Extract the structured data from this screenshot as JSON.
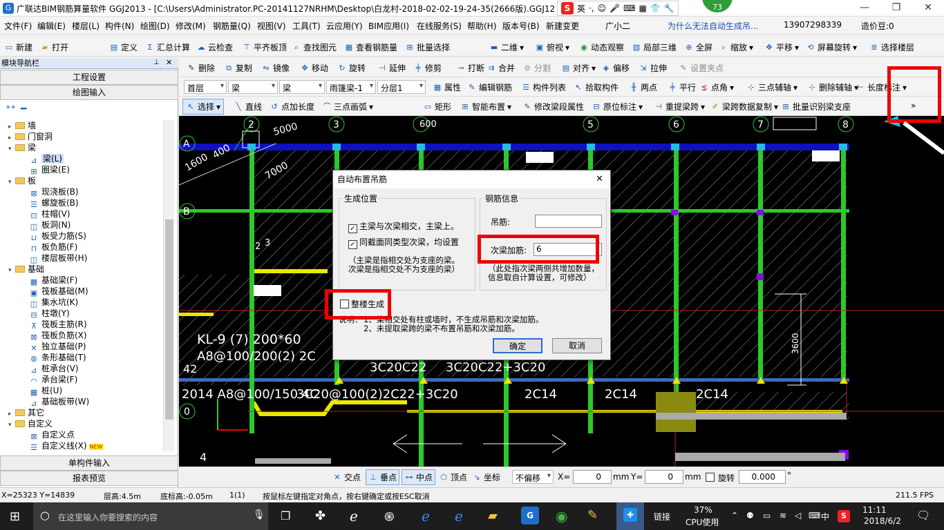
{
  "window": {
    "title": "广联达BIM钢筋算量软件 GGJ2013 - [C:\\Users\\Administrator.PC-20141127NRHM\\Desktop\\白龙村-2018-02-02-19-24-35(2666版).GGJ12]",
    "badge": "73",
    "ime_lang": "英",
    "min": "—",
    "restore": "❐",
    "close": "✕"
  },
  "menu": [
    "文件(F)",
    "编辑(E)",
    "楼层(L)",
    "构件(N)",
    "绘图(D)",
    "修改(M)",
    "钢筋量(Q)",
    "视图(V)",
    "工具(T)",
    "云应用(Y)",
    "BIM应用(I)",
    "在线服务(S)",
    "帮助(H)",
    "版本号(B)",
    "新建变更",
    "广小二",
    "为什么无法自动生成吊...",
    "13907298339",
    "造价豆:0"
  ],
  "toolbar1": [
    "新建",
    "打开",
    "定义",
    "汇总计算",
    "云检查",
    "平齐板顶",
    "查找图元",
    "查看钢筋量",
    "批量选择",
    "二维",
    "俯视",
    "动态观察",
    "局部三维",
    "全屏",
    "缩放",
    "平移",
    "屏幕旋转",
    "选择楼层"
  ],
  "toolbar2": [
    "删除",
    "复制",
    "镜像",
    "移动",
    "旋转",
    "延伸",
    "修剪",
    "打断",
    "合并",
    "分割",
    "对齐",
    "偏移",
    "拉伸",
    "设置夹点"
  ],
  "toolbar3": {
    "floor": "首层",
    "cat": "梁",
    "type": "梁",
    "member": "雨篷梁-1",
    "layer": "分层1",
    "items": [
      "属性",
      "编辑钢筋",
      "构件列表",
      "拾取构件",
      "两点",
      "平行",
      "点角",
      "三点辅轴",
      "删除辅轴",
      "长度标注"
    ]
  },
  "toolbar4": [
    "选择",
    "直线",
    "点加长度",
    "三点画弧",
    "矩形",
    "智能布置",
    "修改梁段属性",
    "原位标注",
    "重提梁跨",
    "梁跨数据复制",
    "批量识别梁支座"
  ],
  "nav": {
    "header": "模块导航栏",
    "btn_project": "工程设置",
    "btn_draw": "绘图输入",
    "btn_single": "单构件输入",
    "btn_report": "报表预览",
    "tree": [
      {
        "label": "墙",
        "lvl": 0,
        "exp": "▸"
      },
      {
        "label": "门窗洞",
        "lvl": 0,
        "exp": "▸"
      },
      {
        "label": "梁",
        "lvl": 0,
        "exp": "▾"
      },
      {
        "label": "梁(L)",
        "lvl": 1,
        "sel": true
      },
      {
        "label": "圈梁(E)",
        "lvl": 1
      },
      {
        "label": "板",
        "lvl": 0,
        "exp": "▾"
      },
      {
        "label": "现浇板(B)",
        "lvl": 1
      },
      {
        "label": "螺旋板(B)",
        "lvl": 1
      },
      {
        "label": "柱帽(V)",
        "lvl": 1
      },
      {
        "label": "板洞(N)",
        "lvl": 1
      },
      {
        "label": "板受力筋(S)",
        "lvl": 1
      },
      {
        "label": "板负筋(F)",
        "lvl": 1
      },
      {
        "label": "楼层板带(H)",
        "lvl": 1
      },
      {
        "label": "基础",
        "lvl": 0,
        "exp": "▾"
      },
      {
        "label": "基础梁(F)",
        "lvl": 1
      },
      {
        "label": "筏板基础(M)",
        "lvl": 1
      },
      {
        "label": "集水坑(K)",
        "lvl": 1
      },
      {
        "label": "柱墩(Y)",
        "lvl": 1
      },
      {
        "label": "筏板主筋(R)",
        "lvl": 1
      },
      {
        "label": "筏板负筋(X)",
        "lvl": 1
      },
      {
        "label": "独立基础(P)",
        "lvl": 1
      },
      {
        "label": "条形基础(T)",
        "lvl": 1
      },
      {
        "label": "桩承台(V)",
        "lvl": 1
      },
      {
        "label": "承台梁(F)",
        "lvl": 1
      },
      {
        "label": "桩(U)",
        "lvl": 1
      },
      {
        "label": "基础板带(W)",
        "lvl": 1
      },
      {
        "label": "其它",
        "lvl": 0,
        "exp": "▸"
      },
      {
        "label": "自定义",
        "lvl": 0,
        "exp": "▾"
      },
      {
        "label": "自定义点",
        "lvl": 1
      },
      {
        "label": "自定义线(X)",
        "lvl": 1,
        "tag": "NEW"
      }
    ]
  },
  "drawing": {
    "axes": [
      "2",
      "3",
      "5",
      "6",
      "7",
      "8"
    ],
    "axis_a": "A",
    "axis_b": "B",
    "axis_0": "0",
    "dims": [
      "5000",
      "600",
      "1600",
      "400",
      "7000",
      "3600"
    ],
    "labels": [
      "KL-9 (7)  200*60",
      "A8@100/200(2)  2C",
      "3C20C22",
      "3C20C22+3C20",
      "2C14",
      "2C14",
      "2C14",
      "2014 A8@100/150 4C",
      "3C20@100(2)2C22+3C20",
      "42",
      "4",
      "0",
      "2",
      "3",
      "C"
    ]
  },
  "dialog": {
    "title": "自动布置吊筋",
    "close": "✕",
    "grp_pos": "生成位置",
    "cb1": "主梁与次梁相交，主梁上。",
    "cb2": "同截面同类型次梁，均设置",
    "note1": "（主梁是指相交处为支座的梁。",
    "note2": "次梁是指相交处不为支座的梁）",
    "grp_rebar": "钢筋信息",
    "lbl_hanger": "吊筋:",
    "val_hanger": "",
    "lbl_sec": "次梁加筋:",
    "val_sec": "6",
    "note3": "（此处指次梁两侧共增加数量，",
    "note4": "信息取自计算设置，可修改）",
    "cb3": "整楼生成",
    "remark_head": "说明：",
    "remark1": "1、梁相交处有柱或墙时，不生成吊筋和次梁加筋。",
    "remark2": "2、未提取梁跨的梁不布置吊筋和次梁加筋。",
    "ok": "确定",
    "cancel": "取消",
    "cb1_checked": "✓",
    "cb2_checked": "✓",
    "cb3_checked": ""
  },
  "snap": {
    "items": [
      "交点",
      "垂点",
      "中点",
      "顶点",
      "坐标"
    ],
    "offset": "不偏移",
    "x_label": "X=",
    "x_val": "0",
    "unit1": "mm",
    "y_label": "Y=",
    "y_val": "0",
    "unit2": "mm",
    "rot_label": "旋转",
    "rot_val": "0.000",
    "deg": "°"
  },
  "status": {
    "coord": "X=25323 Y=14839",
    "floor_h": "层高:4.5m",
    "base_h": "底标高:-0.05m",
    "count": "1(1)",
    "hint": "按鼠标左键指定对角点，按右键确定或按ESC取消",
    "fps": "211.5 FPS"
  },
  "taskbar": {
    "search": "在这里输入你要搜索的内容",
    "link": "链接",
    "cpu_pct": "37%",
    "cpu_label": "CPU使用",
    "lang": "中",
    "time": "11:11",
    "date": "2018/6/2"
  }
}
